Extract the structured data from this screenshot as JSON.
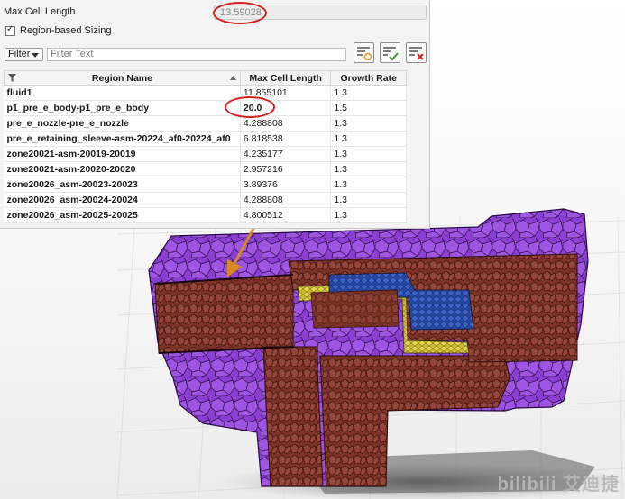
{
  "settings": {
    "max_cell_length_label": "Max Cell Length",
    "max_cell_length_value": "13.59028",
    "region_based_sizing_label": "Region-based Sizing",
    "region_based_sizing_checked": true,
    "filter_button_label": "Filter",
    "filter_placeholder": "Filter Text"
  },
  "table": {
    "columns": [
      "Region Name",
      "Max Cell Length",
      "Growth Rate"
    ],
    "rows": [
      {
        "name": "fluid1",
        "max_cell_length": "11.855101",
        "growth_rate": "1.3"
      },
      {
        "name": "p1_pre_e_body-p1_pre_e_body",
        "max_cell_length": "20.0",
        "growth_rate": "1.5"
      },
      {
        "name": "pre_e_nozzle-pre_e_nozzle",
        "max_cell_length": "4.288808",
        "growth_rate": "1.3"
      },
      {
        "name": "pre_e_retaining_sleeve-asm-20224_af0-20224_af0",
        "max_cell_length": "6.818538",
        "growth_rate": "1.3"
      },
      {
        "name": "zone20021-asm-20019-20019",
        "max_cell_length": "4.235177",
        "growth_rate": "1.3"
      },
      {
        "name": "zone20021-asm-20020-20020",
        "max_cell_length": "2.957216",
        "growth_rate": "1.3"
      },
      {
        "name": "zone20026_asm-20023-20023",
        "max_cell_length": "3.89376",
        "growth_rate": "1.3"
      },
      {
        "name": "zone20026_asm-20024-20024",
        "max_cell_length": "4.288808",
        "growth_rate": "1.3"
      },
      {
        "name": "zone20026_asm-20025-20025",
        "max_cell_length": "4.800512",
        "growth_rate": "1.3"
      }
    ]
  },
  "watermark": "bilibili 艾迪捷",
  "colors": {
    "purple_mesh": "#8a3fd0",
    "brown_mesh": "#8a3a2e",
    "yellow_mesh": "#d8c63a",
    "blue_mesh": "#2a4fb0",
    "annotation_red": "#d42020",
    "arrow_orange": "#d68a1c"
  },
  "icons": [
    "filter-funnel-icon",
    "filter-settings-icon",
    "filter-apply-icon",
    "filter-clear-icon",
    "sort-caret-icon",
    "checkbox-checked-icon"
  ]
}
